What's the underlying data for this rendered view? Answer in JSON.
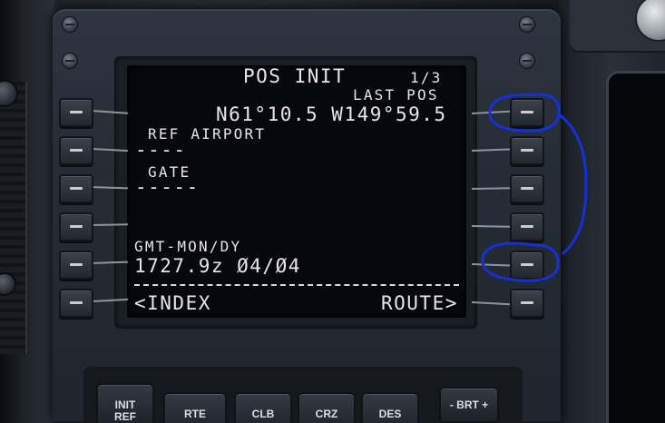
{
  "cdu": {
    "title": "POS INIT",
    "page": "1/3",
    "lines": {
      "l1_header": "",
      "r1_header": "LAST POS",
      "r1_value": "N61°10.5 W149°59.5",
      "l2_header": "REF AIRPORT",
      "l2_value": "----",
      "l3_header": "GATE",
      "l3_value": "-----",
      "l5_header": "GMT-MON/DY",
      "l5_value": "1727.9z Ø4/Ø4",
      "l6_left": "<INDEX",
      "r6_right": "ROUTE>"
    }
  },
  "function_keys": [
    {
      "label_line1": "INIT",
      "label_line2": "REF"
    },
    {
      "label_line1": "RTE",
      "label_line2": ""
    },
    {
      "label_line1": "CLB",
      "label_line2": ""
    },
    {
      "label_line1": "CRZ",
      "label_line2": ""
    },
    {
      "label_line1": "DES",
      "label_line2": ""
    },
    {
      "label_line1": "- BRT +",
      "label_line2": ""
    }
  ],
  "colors": {
    "screen_text": "#e6e6e6",
    "screen_bg": "#07080e",
    "annotation": "#1530d6"
  }
}
